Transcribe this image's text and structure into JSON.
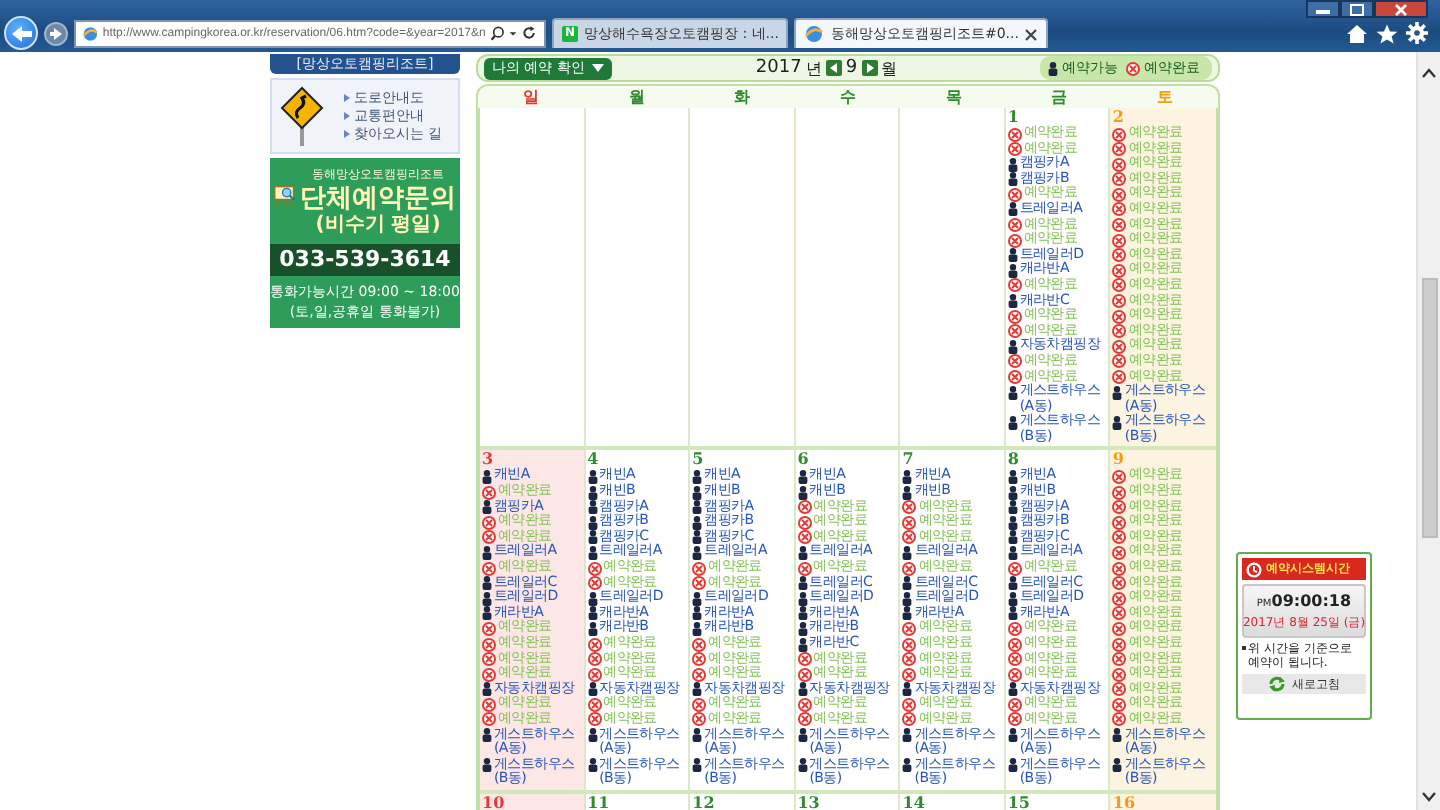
{
  "browser": {
    "address": "http://www.campingkorea.or.kr/reservation/06.htm?code=&year=2017&n",
    "tabs": [
      {
        "badge": "N",
        "label": "망상해수욕장오토캠핑장 : 네...",
        "selected": false
      },
      {
        "label": "동해망상오토캠핑리조트#0...",
        "selected": true
      }
    ]
  },
  "sidebar": {
    "title": "[망상오토캠핑리조트]",
    "links": [
      "도로안내도",
      "교통편안내",
      "찾아오시는 길"
    ],
    "banner": {
      "org": "동해망상오토캠핑리조트",
      "heading": "단체예약문의",
      "subheading": "(비수기 평일)",
      "phone": "033-539-3614",
      "hours": "통화가능시간 09:00 ~ 18:00",
      "note": "(토,일,공휴일 통화불가)"
    }
  },
  "calendar": {
    "my_reservation_button": "나의 예약 확인",
    "year": "2017",
    "year_unit": "년",
    "month": "9",
    "month_unit": "월",
    "legend": [
      {
        "kind": "open",
        "label": "예약가능"
      },
      {
        "kind": "booked",
        "label": "예약완료"
      }
    ],
    "weekdays": [
      {
        "kind": "sun",
        "label": "일"
      },
      {
        "kind": "weekday",
        "label": "월"
      },
      {
        "kind": "weekday",
        "label": "화"
      },
      {
        "kind": "weekday",
        "label": "수"
      },
      {
        "kind": "weekday",
        "label": "목"
      },
      {
        "kind": "weekday",
        "label": "금"
      },
      {
        "kind": "sat",
        "label": "토"
      }
    ],
    "weeks": [
      [
        {
          "kind": "blank"
        },
        {
          "kind": "blank"
        },
        {
          "kind": "blank"
        },
        {
          "kind": "blank"
        },
        {
          "kind": "blank"
        },
        {
          "kind": "weekday",
          "day": "1",
          "items": [
            {
              "kind": "booked",
              "label": "예약완료"
            },
            {
              "kind": "booked",
              "label": "예약완료"
            },
            {
              "kind": "open",
              "label": "캠핑카A"
            },
            {
              "kind": "open",
              "label": "캠핑카B"
            },
            {
              "kind": "booked",
              "label": "예약완료"
            },
            {
              "kind": "open",
              "label": "트레일러A"
            },
            {
              "kind": "booked",
              "label": "예약완료"
            },
            {
              "kind": "booked",
              "label": "예약완료"
            },
            {
              "kind": "open",
              "label": "트레일러D"
            },
            {
              "kind": "open",
              "label": "캐라반A"
            },
            {
              "kind": "booked",
              "label": "예약완료"
            },
            {
              "kind": "open",
              "label": "캐라반C"
            },
            {
              "kind": "booked",
              "label": "예약완료"
            },
            {
              "kind": "booked",
              "label": "예약완료"
            },
            {
              "kind": "open",
              "label": "자동차캠핑장"
            },
            {
              "kind": "booked",
              "label": "예약완료"
            },
            {
              "kind": "booked",
              "label": "예약완료"
            },
            {
              "kind": "open",
              "label": "게스트하우스(A동)"
            },
            {
              "kind": "open",
              "label": "게스트하우스(B동)"
            }
          ]
        },
        {
          "kind": "sat",
          "day": "2",
          "items": [
            {
              "kind": "booked",
              "label": "예약완료"
            },
            {
              "kind": "booked",
              "label": "예약완료"
            },
            {
              "kind": "booked",
              "label": "예약완료"
            },
            {
              "kind": "booked",
              "label": "예약완료"
            },
            {
              "kind": "booked",
              "label": "예약완료"
            },
            {
              "kind": "booked",
              "label": "예약완료"
            },
            {
              "kind": "booked",
              "label": "예약완료"
            },
            {
              "kind": "booked",
              "label": "예약완료"
            },
            {
              "kind": "booked",
              "label": "예약완료"
            },
            {
              "kind": "booked",
              "label": "예약완료"
            },
            {
              "kind": "booked",
              "label": "예약완료"
            },
            {
              "kind": "booked",
              "label": "예약완료"
            },
            {
              "kind": "booked",
              "label": "예약완료"
            },
            {
              "kind": "booked",
              "label": "예약완료"
            },
            {
              "kind": "booked",
              "label": "예약완료"
            },
            {
              "kind": "booked",
              "label": "예약완료"
            },
            {
              "kind": "booked",
              "label": "예약완료"
            },
            {
              "kind": "open",
              "label": "게스트하우스(A동)"
            },
            {
              "kind": "open",
              "label": "게스트하우스(B동)"
            }
          ]
        }
      ],
      [
        {
          "kind": "sun",
          "day": "3",
          "items": [
            {
              "kind": "open",
              "label": "캐빈A"
            },
            {
              "kind": "booked",
              "label": "예약완료"
            },
            {
              "kind": "open",
              "label": "캠핑카A"
            },
            {
              "kind": "booked",
              "label": "예약완료"
            },
            {
              "kind": "booked",
              "label": "예약완료"
            },
            {
              "kind": "open",
              "label": "트레일러A"
            },
            {
              "kind": "booked",
              "label": "예약완료"
            },
            {
              "kind": "open",
              "label": "트레일러C"
            },
            {
              "kind": "open",
              "label": "트레일러D"
            },
            {
              "kind": "open",
              "label": "캐라반A"
            },
            {
              "kind": "booked",
              "label": "예약완료"
            },
            {
              "kind": "booked",
              "label": "예약완료"
            },
            {
              "kind": "booked",
              "label": "예약완료"
            },
            {
              "kind": "booked",
              "label": "예약완료"
            },
            {
              "kind": "open",
              "label": "자동차캠핑장"
            },
            {
              "kind": "booked",
              "label": "예약완료"
            },
            {
              "kind": "booked",
              "label": "예약완료"
            },
            {
              "kind": "open",
              "label": "게스트하우스(A동)"
            },
            {
              "kind": "open",
              "label": "게스트하우스(B동)"
            }
          ]
        },
        {
          "kind": "weekday",
          "day": "4",
          "items": [
            {
              "kind": "open",
              "label": "캐빈A"
            },
            {
              "kind": "open",
              "label": "캐빈B"
            },
            {
              "kind": "open",
              "label": "캠핑카A"
            },
            {
              "kind": "open",
              "label": "캠핑카B"
            },
            {
              "kind": "open",
              "label": "캠핑카C"
            },
            {
              "kind": "open",
              "label": "트레일러A"
            },
            {
              "kind": "booked",
              "label": "예약완료"
            },
            {
              "kind": "booked",
              "label": "예약완료"
            },
            {
              "kind": "open",
              "label": "트레일러D"
            },
            {
              "kind": "open",
              "label": "캐라반A"
            },
            {
              "kind": "open",
              "label": "캐라반B"
            },
            {
              "kind": "booked",
              "label": "예약완료"
            },
            {
              "kind": "booked",
              "label": "예약완료"
            },
            {
              "kind": "booked",
              "label": "예약완료"
            },
            {
              "kind": "open",
              "label": "자동차캠핑장"
            },
            {
              "kind": "booked",
              "label": "예약완료"
            },
            {
              "kind": "booked",
              "label": "예약완료"
            },
            {
              "kind": "open",
              "label": "게스트하우스(A동)"
            },
            {
              "kind": "open",
              "label": "게스트하우스(B동)"
            }
          ]
        },
        {
          "kind": "weekday",
          "day": "5",
          "items": [
            {
              "kind": "open",
              "label": "캐빈A"
            },
            {
              "kind": "open",
              "label": "캐빈B"
            },
            {
              "kind": "open",
              "label": "캠핑카A"
            },
            {
              "kind": "open",
              "label": "캠핑카B"
            },
            {
              "kind": "open",
              "label": "캠핑카C"
            },
            {
              "kind": "open",
              "label": "트레일러A"
            },
            {
              "kind": "booked",
              "label": "예약완료"
            },
            {
              "kind": "booked",
              "label": "예약완료"
            },
            {
              "kind": "open",
              "label": "트레일러D"
            },
            {
              "kind": "open",
              "label": "캐라반A"
            },
            {
              "kind": "open",
              "label": "캐라반B"
            },
            {
              "kind": "booked",
              "label": "예약완료"
            },
            {
              "kind": "booked",
              "label": "예약완료"
            },
            {
              "kind": "booked",
              "label": "예약완료"
            },
            {
              "kind": "open",
              "label": "자동차캠핑장"
            },
            {
              "kind": "booked",
              "label": "예약완료"
            },
            {
              "kind": "booked",
              "label": "예약완료"
            },
            {
              "kind": "open",
              "label": "게스트하우스(A동)"
            },
            {
              "kind": "open",
              "label": "게스트하우스(B동)"
            }
          ]
        },
        {
          "kind": "weekday",
          "day": "6",
          "items": [
            {
              "kind": "open",
              "label": "캐빈A"
            },
            {
              "kind": "open",
              "label": "캐빈B"
            },
            {
              "kind": "booked",
              "label": "예약완료"
            },
            {
              "kind": "booked",
              "label": "예약완료"
            },
            {
              "kind": "booked",
              "label": "예약완료"
            },
            {
              "kind": "open",
              "label": "트레일러A"
            },
            {
              "kind": "booked",
              "label": "예약완료"
            },
            {
              "kind": "open",
              "label": "트레일러C"
            },
            {
              "kind": "open",
              "label": "트레일러D"
            },
            {
              "kind": "open",
              "label": "캐라반A"
            },
            {
              "kind": "open",
              "label": "캐라반B"
            },
            {
              "kind": "open",
              "label": "캐라반C"
            },
            {
              "kind": "booked",
              "label": "예약완료"
            },
            {
              "kind": "booked",
              "label": "예약완료"
            },
            {
              "kind": "open",
              "label": "자동차캠핑장"
            },
            {
              "kind": "booked",
              "label": "예약완료"
            },
            {
              "kind": "booked",
              "label": "예약완료"
            },
            {
              "kind": "open",
              "label": "게스트하우스(A동)"
            },
            {
              "kind": "open",
              "label": "게스트하우스(B동)"
            }
          ]
        },
        {
          "kind": "weekday",
          "day": "7",
          "items": [
            {
              "kind": "open",
              "label": "캐빈A"
            },
            {
              "kind": "open",
              "label": "캐빈B"
            },
            {
              "kind": "booked",
              "label": "예약완료"
            },
            {
              "kind": "booked",
              "label": "예약완료"
            },
            {
              "kind": "booked",
              "label": "예약완료"
            },
            {
              "kind": "open",
              "label": "트레일러A"
            },
            {
              "kind": "booked",
              "label": "예약완료"
            },
            {
              "kind": "open",
              "label": "트레일러C"
            },
            {
              "kind": "open",
              "label": "트레일러D"
            },
            {
              "kind": "open",
              "label": "캐라반A"
            },
            {
              "kind": "booked",
              "label": "예약완료"
            },
            {
              "kind": "booked",
              "label": "예약완료"
            },
            {
              "kind": "booked",
              "label": "예약완료"
            },
            {
              "kind": "booked",
              "label": "예약완료"
            },
            {
              "kind": "open",
              "label": "자동차캠핑장"
            },
            {
              "kind": "booked",
              "label": "예약완료"
            },
            {
              "kind": "booked",
              "label": "예약완료"
            },
            {
              "kind": "open",
              "label": "게스트하우스(A동)"
            },
            {
              "kind": "open",
              "label": "게스트하우스(B동)"
            }
          ]
        },
        {
          "kind": "weekday",
          "day": "8",
          "items": [
            {
              "kind": "open",
              "label": "캐빈A"
            },
            {
              "kind": "open",
              "label": "캐빈B"
            },
            {
              "kind": "open",
              "label": "캠핑카A"
            },
            {
              "kind": "open",
              "label": "캠핑카B"
            },
            {
              "kind": "open",
              "label": "캠핑카C"
            },
            {
              "kind": "open",
              "label": "트레일러A"
            },
            {
              "kind": "booked",
              "label": "예약완료"
            },
            {
              "kind": "open",
              "label": "트레일러C"
            },
            {
              "kind": "open",
              "label": "트레일러D"
            },
            {
              "kind": "open",
              "label": "캐라반A"
            },
            {
              "kind": "booked",
              "label": "예약완료"
            },
            {
              "kind": "booked",
              "label": "예약완료"
            },
            {
              "kind": "booked",
              "label": "예약완료"
            },
            {
              "kind": "booked",
              "label": "예약완료"
            },
            {
              "kind": "open",
              "label": "자동차캠핑장"
            },
            {
              "kind": "booked",
              "label": "예약완료"
            },
            {
              "kind": "booked",
              "label": "예약완료"
            },
            {
              "kind": "open",
              "label": "게스트하우스(A동)"
            },
            {
              "kind": "open",
              "label": "게스트하우스(B동)"
            }
          ]
        },
        {
          "kind": "sat",
          "day": "9",
          "items": [
            {
              "kind": "booked",
              "label": "예약완료"
            },
            {
              "kind": "booked",
              "label": "예약완료"
            },
            {
              "kind": "booked",
              "label": "예약완료"
            },
            {
              "kind": "booked",
              "label": "예약완료"
            },
            {
              "kind": "booked",
              "label": "예약완료"
            },
            {
              "kind": "booked",
              "label": "예약완료"
            },
            {
              "kind": "booked",
              "label": "예약완료"
            },
            {
              "kind": "booked",
              "label": "예약완료"
            },
            {
              "kind": "booked",
              "label": "예약완료"
            },
            {
              "kind": "booked",
              "label": "예약완료"
            },
            {
              "kind": "booked",
              "label": "예약완료"
            },
            {
              "kind": "booked",
              "label": "예약완료"
            },
            {
              "kind": "booked",
              "label": "예약완료"
            },
            {
              "kind": "booked",
              "label": "예약완료"
            },
            {
              "kind": "booked",
              "label": "예약완료"
            },
            {
              "kind": "booked",
              "label": "예약완료"
            },
            {
              "kind": "booked",
              "label": "예약완료"
            },
            {
              "kind": "open",
              "label": "게스트하우스(A동)"
            },
            {
              "kind": "open",
              "label": "게스트하우스(B동)"
            }
          ]
        }
      ],
      [
        {
          "kind": "sun",
          "day": "10"
        },
        {
          "kind": "weekday",
          "day": "11"
        },
        {
          "kind": "weekday",
          "day": "12"
        },
        {
          "kind": "weekday",
          "day": "13"
        },
        {
          "kind": "weekday",
          "day": "14"
        },
        {
          "kind": "weekday",
          "day": "15"
        },
        {
          "kind": "sat",
          "day": "16"
        }
      ]
    ]
  },
  "clock": {
    "title": "예약시스템시간",
    "meridiem": "PM",
    "time": "09:00:18",
    "date": "2017년 8월 25일 (금)",
    "note": "위 시간을 기준으로 예약이 됩니다.",
    "refresh_button": "새로고침"
  }
}
